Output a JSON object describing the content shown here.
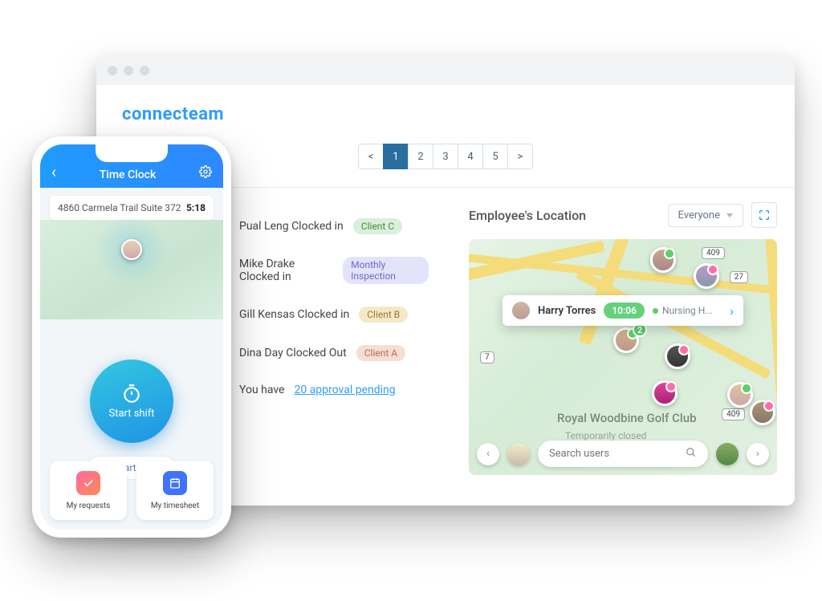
{
  "brand": "connecteam",
  "pager": {
    "prev": "<",
    "pages": [
      "1",
      "2",
      "3",
      "4",
      "5"
    ],
    "next": ">",
    "active": 1
  },
  "feed": {
    "items": [
      {
        "text_a": "Pual Leng Clocked in",
        "chip": "Client C",
        "chip_class": "chip-green",
        "dot": "#5ad16a"
      },
      {
        "text_a": "Mike Drake Clocked in",
        "chip": "Monthly Inspection",
        "chip_class": "chip-purple",
        "dot": "#ff6a6a"
      },
      {
        "text_a": "Gill Kensas Clocked in",
        "chip": "Client B",
        "chip_class": "chip-yellow",
        "dot": "#ff6a6a"
      },
      {
        "text_a": "Dina Day Clocked Out",
        "chip": "Client A",
        "chip_class": "chip-peach",
        "dot": "#333"
      }
    ],
    "footer_a": "You have ",
    "footer_link": "20 approval pending"
  },
  "right": {
    "title": "Employee's Location",
    "filter": "Everyone",
    "search_placeholder": "Search users",
    "map_label": "Royal Woodbine Golf Club",
    "map_sub": "Temporarily closed",
    "shields": {
      "a": "409",
      "b": "27",
      "c": "7",
      "d": "409"
    },
    "cluster": "2",
    "tooltip": {
      "name": "Harry Torres",
      "time": "10:06",
      "loc": "Nursing H..."
    }
  },
  "phone": {
    "title": "Time Clock",
    "address": "4860 Carmela Trail Suite 372",
    "time": "5:18",
    "start": "Start shift",
    "break": "Start break",
    "tile_a": "My requests",
    "tile_b": "My timesheet"
  }
}
